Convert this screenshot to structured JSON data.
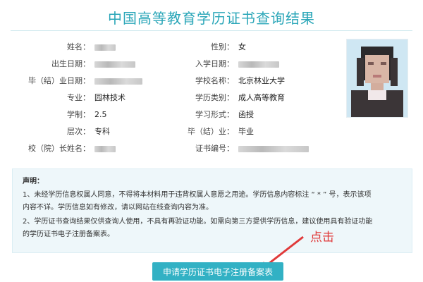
{
  "page": {
    "title": "中国高等教育学历证书查询结果"
  },
  "fields": {
    "name": {
      "label": "姓名："
    },
    "gender": {
      "label": "性别：",
      "value": "女"
    },
    "birth": {
      "label": "出生日期："
    },
    "enroll": {
      "label": "入学日期："
    },
    "graduate": {
      "label": "毕（结）业日期："
    },
    "school": {
      "label": "学校名称：",
      "value": "北京林业大学"
    },
    "major": {
      "label": "专业：",
      "value": "园林技术"
    },
    "edu_type": {
      "label": "学历类别：",
      "value": "成人高等教育"
    },
    "duration": {
      "label": "学制：",
      "value": "2.5"
    },
    "study_form": {
      "label": "学习形式：",
      "value": "函授"
    },
    "level": {
      "label": "层次：",
      "value": "专科"
    },
    "completion": {
      "label": "毕（结）业：",
      "value": "毕业"
    },
    "president": {
      "label": "校（院）长姓名："
    },
    "cert_no": {
      "label": "证书编号："
    }
  },
  "notice": {
    "heading": "声明：",
    "lines": [
      "1、未经学历信息权属人同意，不得将本材料用于违背权属人意愿之用途。学历信息内容标注 “ * ” 号，表示该项",
      "内容不详。学历信息如有修改，请以网站在线查询内容为准。",
      "2、学历证书查询结果仅供查询人使用，不具有再验证功能。如需向第三方提供学历信息，建议使用具有验证功能",
      "的学历证书电子注册备案表。"
    ]
  },
  "actions": {
    "apply_label": "申请学历证书电子注册备案表"
  },
  "annotation": {
    "text": "点击"
  },
  "colors": {
    "accent": "#2aa6b8",
    "button": "#32b1c4",
    "annotation": "#e03a3a"
  }
}
